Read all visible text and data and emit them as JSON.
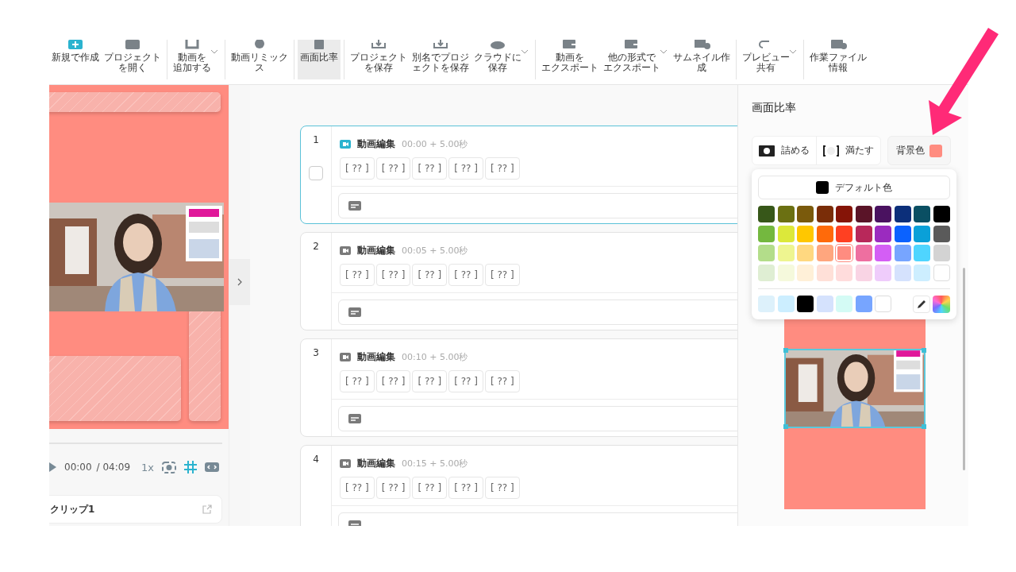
{
  "toolbar": {
    "groups": [
      [
        {
          "lines": [
            "新規で作成"
          ],
          "kind": "new",
          "selected": false,
          "dropdown": false
        },
        {
          "lines": [
            "プロジェクト",
            "を開く"
          ],
          "kind": "open",
          "selected": false,
          "dropdown": false
        }
      ],
      [
        {
          "lines": [
            "動画を",
            "追加する"
          ],
          "kind": "add",
          "selected": false,
          "dropdown": true
        }
      ],
      [
        {
          "lines": [
            "動画リミック",
            "ス"
          ],
          "kind": "remix",
          "selected": false,
          "dropdown": false
        }
      ],
      [
        {
          "lines": [
            "画面比率"
          ],
          "kind": "ratio",
          "selected": true,
          "dropdown": false
        }
      ],
      [
        {
          "lines": [
            "プロジェクト",
            "を保存"
          ],
          "kind": "save",
          "selected": false,
          "dropdown": false
        },
        {
          "lines": [
            "別名でプロジ",
            "ェクトを保存"
          ],
          "kind": "save",
          "selected": false,
          "dropdown": false
        },
        {
          "lines": [
            "クラウドに",
            "保存"
          ],
          "kind": "cloud",
          "selected": false,
          "dropdown": true
        }
      ],
      [
        {
          "lines": [
            "動画を",
            "エクスポート"
          ],
          "kind": "export",
          "selected": false,
          "dropdown": false
        },
        {
          "lines": [
            "他の形式で",
            "エクスポート"
          ],
          "kind": "export",
          "selected": false,
          "dropdown": true
        },
        {
          "lines": [
            "サムネイル作",
            "成"
          ],
          "kind": "thumb",
          "selected": false,
          "dropdown": false
        }
      ],
      [
        {
          "lines": [
            "プレビュー",
            "共有"
          ],
          "kind": "share",
          "selected": false,
          "dropdown": true
        }
      ],
      [
        {
          "lines": [
            "作業ファイル",
            "情報"
          ],
          "kind": "info",
          "selected": false,
          "dropdown": false
        }
      ]
    ]
  },
  "player": {
    "time": "00:00",
    "duration": "/ 04:09",
    "speed": "1x",
    "grid_on": true
  },
  "clip": {
    "label": "クリップ1"
  },
  "scenes": [
    {
      "number": "1",
      "title": "動画編集",
      "time": "00:00 + 5.00秒",
      "selected": true,
      "checkbox": {
        "checked": false
      },
      "chips": [
        "[ ?? ]",
        "[ ?? ]",
        "[ ?? ]",
        "[ ?? ]",
        "[ ?? ]"
      ]
    },
    {
      "number": "2",
      "title": "動画編集",
      "time": "00:05 + 5.00秒",
      "selected": false,
      "chips": [
        "[ ?? ]",
        "[ ?? ]",
        "[ ?? ]",
        "[ ?? ]",
        "[ ?? ]"
      ]
    },
    {
      "number": "3",
      "title": "動画編集",
      "time": "00:10 + 5.00秒",
      "selected": false,
      "chips": [
        "[ ?? ]",
        "[ ?? ]",
        "[ ?? ]",
        "[ ?? ]",
        "[ ?? ]"
      ]
    },
    {
      "number": "4",
      "title": "動画編集",
      "time": "00:15 + 5.00秒",
      "selected": false,
      "chips": [
        "[ ?? ]",
        "[ ?? ]",
        "[ ?? ]",
        "[ ?? ]",
        "[ ?? ]"
      ]
    }
  ],
  "panel": {
    "title": "画面比率",
    "fit_options": [
      {
        "label": "詰める",
        "kind": "fit"
      },
      {
        "label": "満たす",
        "kind": "fill"
      }
    ],
    "background": {
      "label": "背景色",
      "color": "#ff8c80"
    },
    "default_color": {
      "label": "デフォルト色",
      "color": "#000000"
    },
    "palette": [
      [
        {
          "color": "#375719",
          "selected": false
        },
        {
          "color": "#6b7012",
          "selected": false
        },
        {
          "color": "#7a5a0c",
          "selected": false
        },
        {
          "color": "#7a2d08",
          "selected": false
        },
        {
          "color": "#851407",
          "selected": false
        },
        {
          "color": "#5a1428",
          "selected": false
        },
        {
          "color": "#4a1260",
          "selected": false
        },
        {
          "color": "#0c2f7a",
          "selected": false
        },
        {
          "color": "#0a4f63",
          "selected": false
        },
        {
          "color": "#000000",
          "selected": false
        }
      ],
      [
        {
          "color": "#74b83f",
          "selected": false
        },
        {
          "color": "#dce83a",
          "selected": false
        },
        {
          "color": "#ffc700",
          "selected": false
        },
        {
          "color": "#ff6a0a",
          "selected": false
        },
        {
          "color": "#ff4022",
          "selected": false
        },
        {
          "color": "#b8285a",
          "selected": false
        },
        {
          "color": "#9b2bbf",
          "selected": false
        },
        {
          "color": "#0b62ff",
          "selected": false
        },
        {
          "color": "#0aa0d8",
          "selected": false
        },
        {
          "color": "#5a5a5a",
          "selected": false
        }
      ],
      [
        {
          "color": "#b3dd8a",
          "selected": false
        },
        {
          "color": "#eef590",
          "selected": false
        },
        {
          "color": "#ffd880",
          "selected": false
        },
        {
          "color": "#ffa67e",
          "selected": false
        },
        {
          "color": "#ff8c80",
          "selected": true
        },
        {
          "color": "#ee6fa0",
          "selected": false
        },
        {
          "color": "#d45ef5",
          "selected": false
        },
        {
          "color": "#77a5ff",
          "selected": false
        },
        {
          "color": "#4fd5ff",
          "selected": false
        },
        {
          "color": "#d3d3d3",
          "selected": false
        }
      ],
      [
        {
          "color": "#dfeed3",
          "selected": false
        },
        {
          "color": "#f5f9dc",
          "selected": false
        },
        {
          "color": "#fff0d8",
          "selected": false
        },
        {
          "color": "#ffe0d8",
          "selected": false
        },
        {
          "color": "#ffdcdc",
          "selected": false
        },
        {
          "color": "#f9d4e4",
          "selected": false
        },
        {
          "color": "#efccfb",
          "selected": false
        },
        {
          "color": "#d5e2fd",
          "selected": false
        },
        {
          "color": "#cdeeff",
          "selected": false
        },
        {
          "color": "#ffffff",
          "selected": false
        }
      ]
    ],
    "recent": [
      {
        "color": "#ddf1fb"
      },
      {
        "color": "#cceeff"
      },
      {
        "color": "#000000"
      },
      {
        "color": "#d5e2fd"
      },
      {
        "color": "#d4fbf5"
      },
      {
        "color": "#77a5ff"
      },
      {
        "color": "#ffffff"
      }
    ]
  }
}
